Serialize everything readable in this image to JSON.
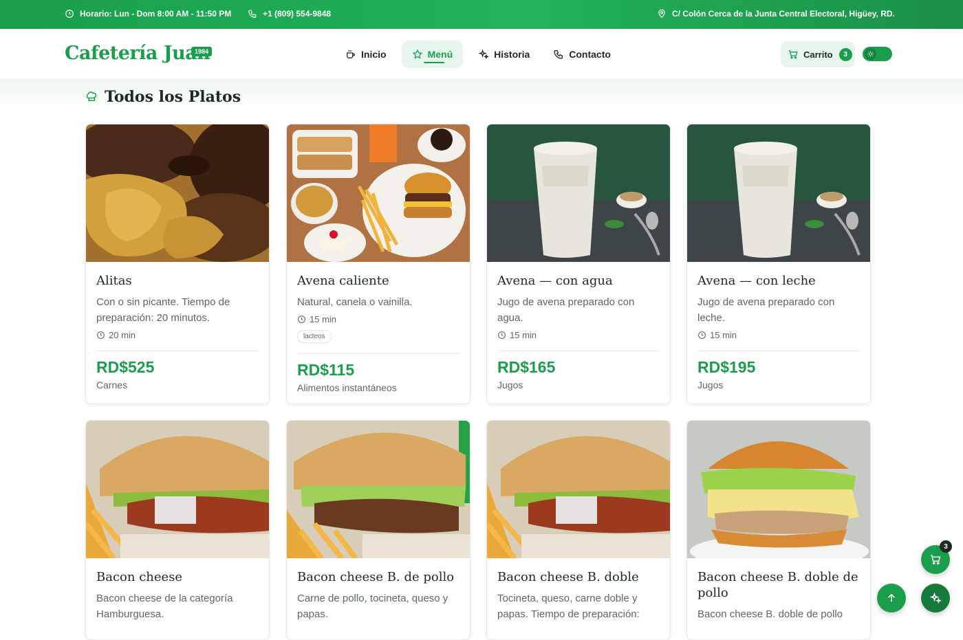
{
  "topbar": {
    "hours": "Horario: Lun - Dom 8:00 AM - 11:50 PM",
    "phone": "+1 (809) 554-9848",
    "address": "C/ Colón Cerca de la Junta Central Electoral, Higüey, RD."
  },
  "header": {
    "logo": "Cafetería Juan",
    "logo_badge": "1984",
    "nav": [
      "Inicio",
      "Menú",
      "Historia",
      "Contacto"
    ],
    "active_nav": "Menú",
    "cart_label": "Carrito",
    "cart_count": "3"
  },
  "section": {
    "title": "Todos los Platos"
  },
  "dishes": [
    {
      "name": "Alitas",
      "desc": "Con o sin picante. Tiempo de preparación: 20 minutos.",
      "time": "20 min",
      "tag": "",
      "price": "RD$525",
      "category": "Carnes",
      "image": "wings"
    },
    {
      "name": "Avena caliente",
      "desc": "Natural, canela o vainilla.",
      "time": "15 min",
      "tag": "lacteos",
      "price": "RD$115",
      "category": "Alimentos instantáneos",
      "image": "breakfast"
    },
    {
      "name": "Avena — con agua",
      "desc": "Jugo de avena preparado con agua.",
      "time": "15 min",
      "tag": "",
      "price": "RD$165",
      "category": "Jugos",
      "image": "oat-drink"
    },
    {
      "name": "Avena — con leche",
      "desc": "Jugo de avena preparado con leche.",
      "time": "15 min",
      "tag": "",
      "price": "RD$195",
      "category": "Jugos",
      "image": "oat-drink"
    },
    {
      "name": "Bacon cheese",
      "desc": "Bacon cheese de la categoría Hamburguesa.",
      "image": "burger"
    },
    {
      "name": "Bacon cheese B. de pollo",
      "desc": "Carne de pollo, tocineta, queso y papas.",
      "image": "burger"
    },
    {
      "name": "Bacon cheese B. doble",
      "desc": "Tocineta, queso, carne doble y papas. Tiempo de preparación:",
      "image": "burger"
    },
    {
      "name": "Bacon cheese B. doble de pollo",
      "desc": "Bacon cheese B. doble de pollo",
      "image": "chicken-burger"
    }
  ],
  "floating": {
    "cart_badge": "3"
  },
  "colors": {
    "brand": "#1a9e4c",
    "text": "#1f2a24",
    "muted": "#5d6862"
  }
}
